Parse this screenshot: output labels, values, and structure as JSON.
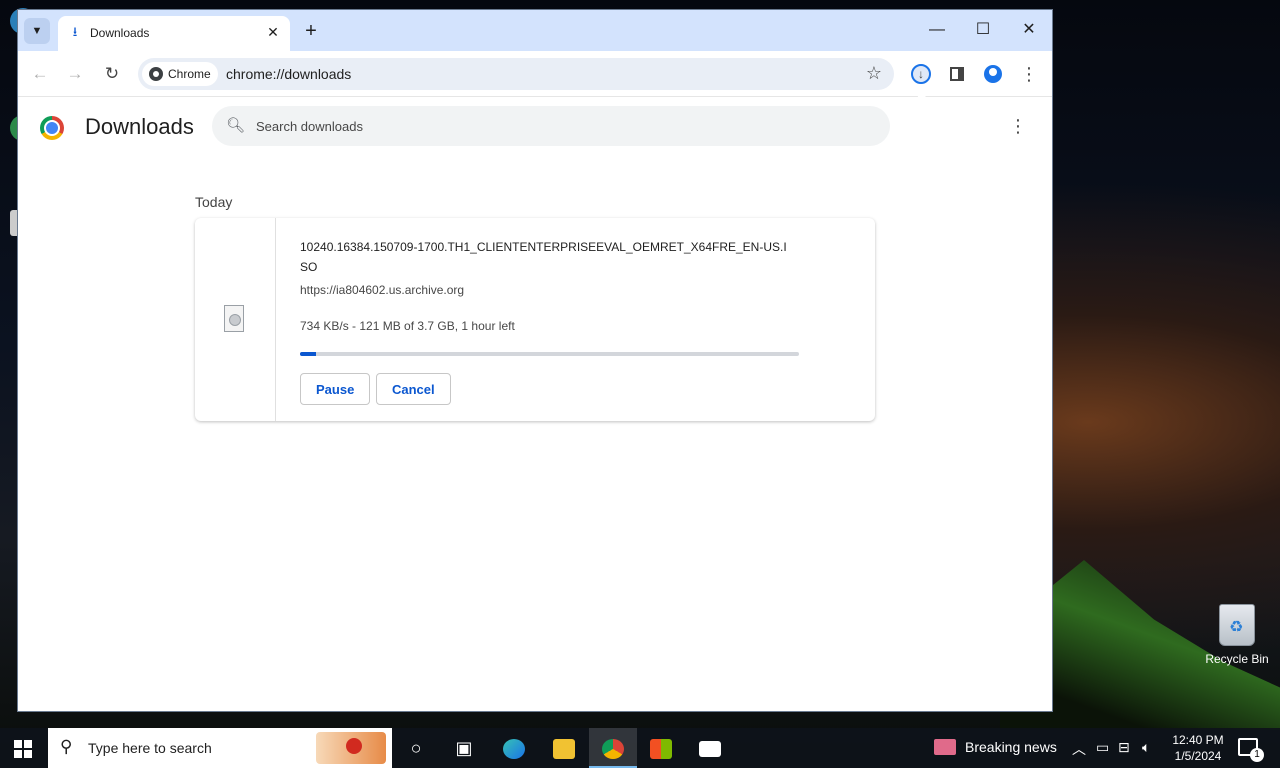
{
  "desktop": {
    "recycle_bin_label": "Recycle Bin"
  },
  "browser": {
    "tab": {
      "title": "Downloads"
    },
    "chip_label": "Chrome",
    "url": "chrome://downloads",
    "accent": "#0b57d0",
    "tabstrip_color": "#d3e3fd"
  },
  "page": {
    "title": "Downloads",
    "search_placeholder": "Search downloads",
    "section_label": "Today",
    "download": {
      "filename": "10240.16384.150709-1700.TH1_CLIENTENTERPRISEEVAL_OEMRET_X64FRE_EN-US.ISO",
      "source": "https://ia804602.us.archive.org",
      "status": "734 KB/s - 121 MB of 3.7 GB, 1 hour left",
      "progress_fraction": 0.032,
      "pause_label": "Pause",
      "cancel_label": "Cancel"
    }
  },
  "taskbar": {
    "search_placeholder": "Type here to search",
    "news_label": "Breaking news",
    "time": "12:40 PM",
    "date": "1/5/2024",
    "notification_count": "1"
  }
}
